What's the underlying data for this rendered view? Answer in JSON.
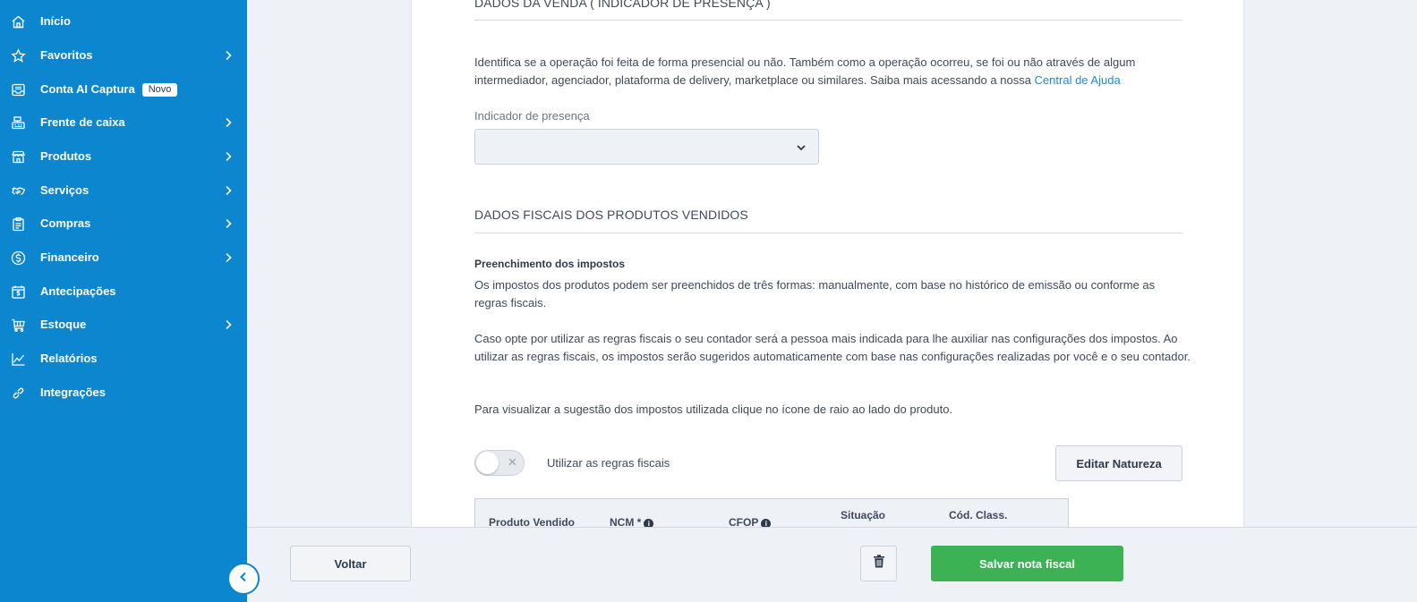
{
  "sidebar": {
    "items": [
      {
        "label": "Início",
        "icon": "home-icon"
      },
      {
        "label": "Favoritos",
        "icon": "star-icon",
        "has_chevron": true
      },
      {
        "label": "Conta AI Captura",
        "icon": "inbox-icon",
        "badge": "Novo"
      },
      {
        "label": "Frente de caixa",
        "icon": "cash-register-icon",
        "has_chevron": true
      },
      {
        "label": "Produtos",
        "icon": "store-icon",
        "has_chevron": true
      },
      {
        "label": "Serviços",
        "icon": "handshake-icon",
        "has_chevron": true
      },
      {
        "label": "Compras",
        "icon": "clipboard-icon",
        "has_chevron": true
      },
      {
        "label": "Financeiro",
        "icon": "dollar-circle-icon",
        "has_chevron": true
      },
      {
        "label": "Antecipações",
        "icon": "calendar-dollar-icon"
      },
      {
        "label": "Estoque",
        "icon": "cart-icon",
        "has_chevron": true
      },
      {
        "label": "Relatórios",
        "icon": "line-chart-icon"
      },
      {
        "label": "Integrações",
        "icon": "link-icon"
      }
    ],
    "collapse_icon": "chevron-left-icon"
  },
  "main": {
    "sale_section_title": "DADOS DA VENDA ( INDICADOR DE PRESENÇA )",
    "sale_description": "Identifica se a operação foi feita de forma presencial ou não. Também como a operação ocorreu, se foi ou não através de algum intermediador, agenciador, plataforma de delivery, marketplace ou similares. Saiba mais acessando a nossa ",
    "help_link": "Central de Ajuda",
    "presence_label": "Indicador de presença",
    "presence_value": "",
    "fiscal_section_title": "DADOS FISCAIS DOS PRODUTOS VENDIDOS",
    "taxes_subtitle": "Preenchimento dos impostos",
    "taxes_p1": "Os impostos dos produtos podem ser preenchidos de três formas: manualmente, com base no histórico de emissão ou conforme as regras fiscais.",
    "taxes_p2": "Caso opte por utilizar as regras fiscais o seu contador será a pessoa mais indicada para lhe auxiliar nas configurações dos impostos. Ao utilizar as regras fiscais, os impostos serão sugeridos automaticamente com base nas configurações realizadas por você e o seu contador.",
    "taxes_p3": "Para visualizar a sugestão dos impostos utilizada clique no ícone de raio ao lado do produto.",
    "toggle_label": "Utilizar as regras fiscais",
    "toggle_on": false,
    "edit_nature_button": "Editar Natureza",
    "table_headers": {
      "product": "Produto Vendido",
      "ncm": "NCM *",
      "cfop": "CFOP",
      "situacao": "Situação",
      "cod_class": "Cód. Class."
    }
  },
  "footer": {
    "back_button": "Voltar",
    "delete_icon": "trash-icon",
    "save_button": "Salvar nota fiscal"
  },
  "colors": {
    "sidebar_bg": "#0b86cf",
    "save_green": "#3db255",
    "link_blue": "#1b8bd6"
  }
}
